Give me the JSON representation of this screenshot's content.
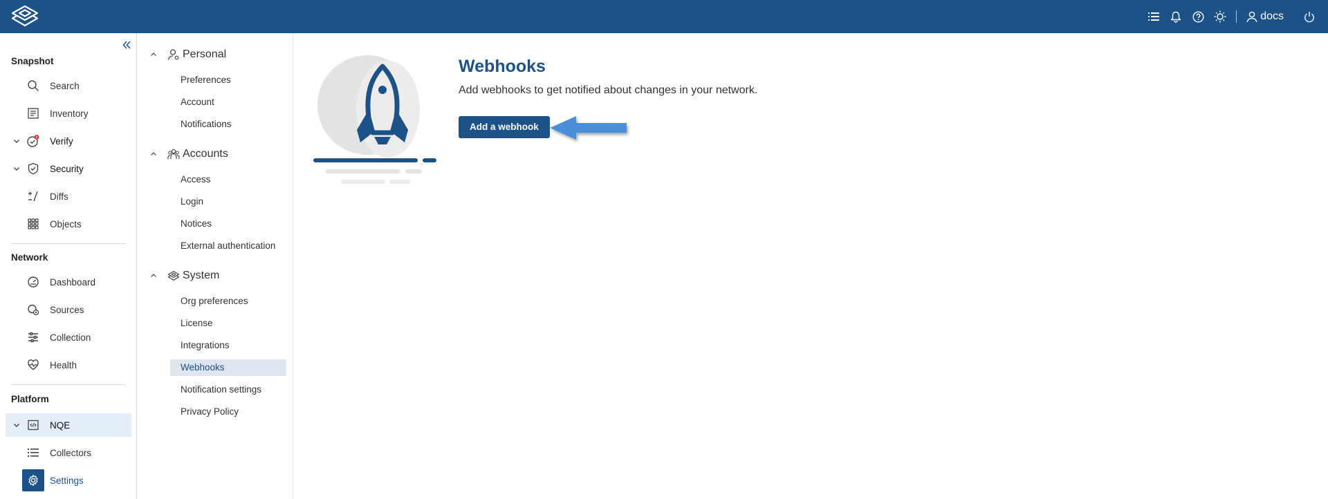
{
  "header": {
    "user_name": "docs",
    "icons": [
      "list-icon",
      "bell-icon",
      "help-icon",
      "theme-icon",
      "user-icon",
      "power-icon"
    ]
  },
  "leftnav": {
    "sections": {
      "snapshot": "Snapshot",
      "network": "Network",
      "platform": "Platform"
    },
    "items": {
      "search": "Search",
      "inventory": "Inventory",
      "verify": "Verify",
      "security": "Security",
      "diffs": "Diffs",
      "objects": "Objects",
      "dashboard": "Dashboard",
      "sources": "Sources",
      "collection": "Collection",
      "health": "Health",
      "nqe": "NQE",
      "collectors": "Collectors",
      "settings": "Settings"
    }
  },
  "settingsnav": {
    "personal": {
      "label": "Personal",
      "items": [
        "Preferences",
        "Account",
        "Notifications"
      ]
    },
    "accounts": {
      "label": "Accounts",
      "items": [
        "Access",
        "Login",
        "Notices",
        "External authentication"
      ]
    },
    "system": {
      "label": "System",
      "items": [
        "Org preferences",
        "License",
        "Integrations",
        "Webhooks",
        "Notification settings",
        "Privacy Policy"
      ]
    },
    "active": "Webhooks"
  },
  "main": {
    "title": "Webhooks",
    "description": "Add webhooks to get notified about changes in your network.",
    "add_button": "Add a webhook"
  },
  "colors": {
    "brand": "#1d5288",
    "active_bg": "#e3eef9",
    "arrow": "#4a90d9"
  }
}
